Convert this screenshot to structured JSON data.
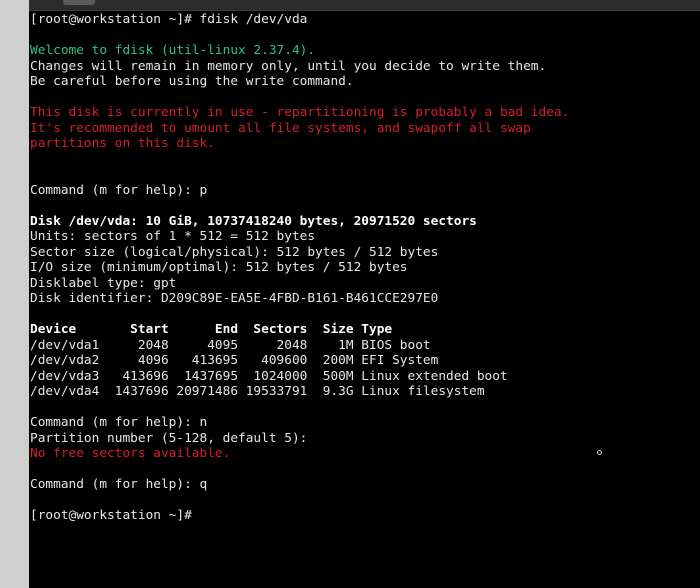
{
  "terminal": {
    "lines": [
      {
        "text": "[root@workstation ~]# fdisk /dev/vda",
        "style": "normal"
      },
      {
        "text": "",
        "style": "normal"
      },
      {
        "text": "Welcome to fdisk (util-linux 2.37.4).",
        "style": "green"
      },
      {
        "text": "Changes will remain in memory only, until you decide to write them.",
        "style": "normal"
      },
      {
        "text": "Be careful before using the write command.",
        "style": "normal"
      },
      {
        "text": "",
        "style": "normal"
      },
      {
        "text": "This disk is currently in use - repartitioning is probably a bad idea.",
        "style": "red"
      },
      {
        "text": "It's recommended to umount all file systems, and swapoff all swap",
        "style": "red"
      },
      {
        "text": "partitions on this disk.",
        "style": "red"
      },
      {
        "text": "",
        "style": "normal"
      },
      {
        "text": "",
        "style": "normal"
      },
      {
        "text": "Command (m for help): p",
        "style": "normal"
      },
      {
        "text": "",
        "style": "normal"
      },
      {
        "text": "Disk /dev/vda: 10 GiB, 10737418240 bytes, 20971520 sectors",
        "style": "bold"
      },
      {
        "text": "Units: sectors of 1 * 512 = 512 bytes",
        "style": "normal"
      },
      {
        "text": "Sector size (logical/physical): 512 bytes / 512 bytes",
        "style": "normal"
      },
      {
        "text": "I/O size (minimum/optimal): 512 bytes / 512 bytes",
        "style": "normal"
      },
      {
        "text": "Disklabel type: gpt",
        "style": "normal"
      },
      {
        "text": "Disk identifier: D209C89E-EA5E-4FBD-B161-B461CCE297E0",
        "style": "normal"
      },
      {
        "text": "",
        "style": "normal"
      },
      {
        "text": "Device       Start      End  Sectors  Size Type",
        "style": "bold"
      },
      {
        "text": "/dev/vda1     2048     4095     2048    1M BIOS boot",
        "style": "normal"
      },
      {
        "text": "/dev/vda2     4096   413695   409600  200M EFI System",
        "style": "normal"
      },
      {
        "text": "/dev/vda3   413696  1437695  1024000  500M Linux extended boot",
        "style": "normal"
      },
      {
        "text": "/dev/vda4  1437696 20971486 19533791  9.3G Linux filesystem",
        "style": "normal"
      },
      {
        "text": "",
        "style": "normal"
      },
      {
        "text": "Command (m for help): n",
        "style": "normal"
      },
      {
        "text": "Partition number (5-128, default 5):",
        "style": "normal"
      },
      {
        "text": "No free sectors available.",
        "style": "red"
      },
      {
        "text": "",
        "style": "normal"
      },
      {
        "text": "Command (m for help): q",
        "style": "normal"
      },
      {
        "text": "",
        "style": "normal"
      },
      {
        "text": "[root@workstation ~]# ",
        "style": "normal"
      }
    ]
  },
  "colors": {
    "background": "#000000",
    "foreground": "#e6e6e6",
    "green": "#2ec27e",
    "red": "#d21f2b"
  }
}
